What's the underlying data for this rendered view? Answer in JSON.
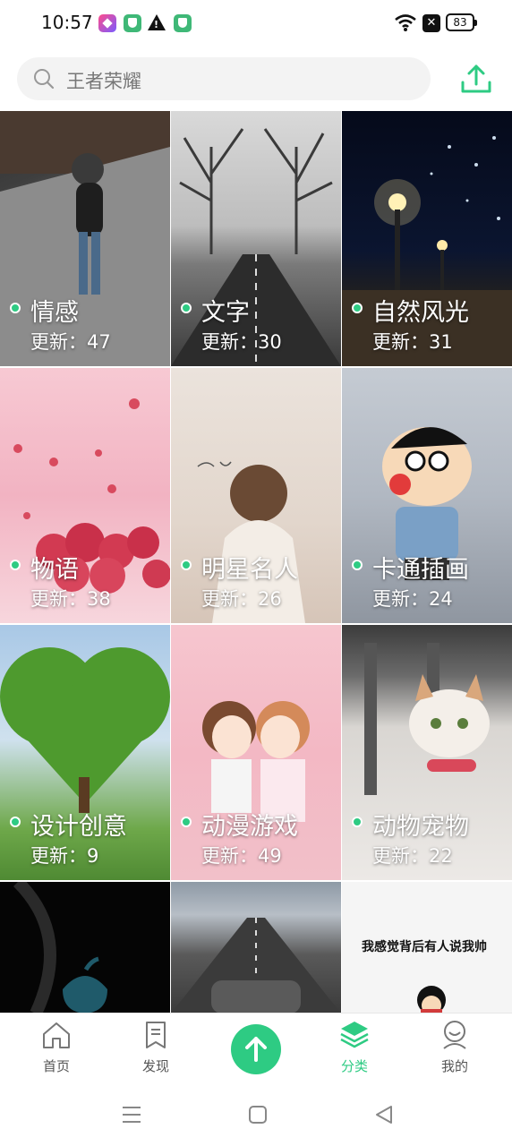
{
  "status_bar": {
    "time": "10:57",
    "battery": "83",
    "icons": [
      "app-notification-icon",
      "shield-icon",
      "warning-icon",
      "shield-icon",
      "wifi-icon",
      "close-icon",
      "battery-icon"
    ]
  },
  "search": {
    "placeholder": "王者荣耀"
  },
  "header": {
    "upload_icon": "upload-icon"
  },
  "categories": [
    {
      "title": "情感",
      "count": "更新：47"
    },
    {
      "title": "文字",
      "count": "更新：30"
    },
    {
      "title": "自然风光",
      "count": "更新：31"
    },
    {
      "title": "物语",
      "count": "更新：38"
    },
    {
      "title": "明星名人",
      "count": "更新：26"
    },
    {
      "title": "卡通插画",
      "count": "更新：24"
    },
    {
      "title": "设计创意",
      "count": "更新：9"
    },
    {
      "title": "动漫游戏",
      "count": "更新：49"
    },
    {
      "title": "动物宠物",
      "count": "更新：22"
    }
  ],
  "partial_tile_text": "我感觉背后有人说我帅",
  "bottom_nav": {
    "items": [
      {
        "label": "首页",
        "icon": "home-icon"
      },
      {
        "label": "发现",
        "icon": "bookmark-icon"
      },
      {
        "label": "分类",
        "icon": "layers-icon",
        "active": true
      },
      {
        "label": "我的",
        "icon": "user-icon"
      }
    ],
    "center_icon": "upload-arrow-icon"
  },
  "colors": {
    "accent": "#2ecb83",
    "search_bg": "#f3f3f3"
  }
}
